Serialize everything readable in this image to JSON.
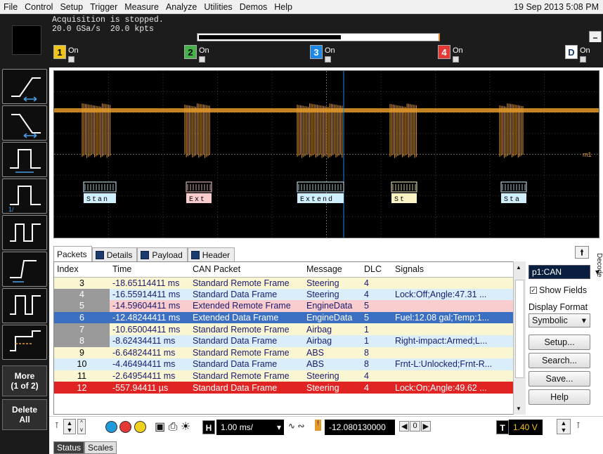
{
  "menu": [
    "File",
    "Control",
    "Setup",
    "Trigger",
    "Measure",
    "Analyze",
    "Utilities",
    "Demos",
    "Help"
  ],
  "clock": "19 Sep 2013  5:08 PM",
  "acquisition": {
    "status": "Acquisition is stopped.",
    "rate": "20.0 GSa/s",
    "points": "20.0 kpts"
  },
  "channels": [
    {
      "num": "1",
      "state": "On",
      "color": "#f0c419"
    },
    {
      "num": "2",
      "state": "On",
      "color": "#46b04a"
    },
    {
      "num": "3",
      "state": "On",
      "color": "#1e88e5"
    },
    {
      "num": "4",
      "state": "On",
      "color": "#e53935"
    },
    {
      "num": "D",
      "state": "On",
      "color": "#ffffff"
    }
  ],
  "scope": {
    "trace_color": "#e59a2c",
    "decode_labels": [
      "Stan",
      "Ext",
      "Extend",
      "St",
      "Sta"
    ],
    "marker": "m1"
  },
  "tabs": [
    "Packets",
    "Details",
    "Payload",
    "Header"
  ],
  "table": {
    "headers": [
      "Index",
      "Time",
      "CAN Packet",
      "Message",
      "DLC",
      "Signals"
    ],
    "rows": [
      {
        "index": "3",
        "time": "-18.65114411 ms",
        "packet": "Standard Remote Frame",
        "message": "Steering",
        "dlc": "4",
        "signals": ""
      },
      {
        "index": "4",
        "time": "-16.55914411 ms",
        "packet": "Standard Data Frame",
        "message": "Steering",
        "dlc": "4",
        "signals": "Lock:Off;Angle:47.31 ..."
      },
      {
        "index": "5",
        "time": "-14.59604411 ms",
        "packet": "Extended Remote Frame",
        "message": "EngineData",
        "dlc": "5",
        "signals": ""
      },
      {
        "index": "6",
        "time": "-12.48244411 ms",
        "packet": "Extended Data Frame",
        "message": "EngineData",
        "dlc": "5",
        "signals": "Fuel:12.08 gal;Temp:1..."
      },
      {
        "index": "7",
        "time": "-10.65004411 ms",
        "packet": "Standard Remote Frame",
        "message": "Airbag",
        "dlc": "1",
        "signals": ""
      },
      {
        "index": "8",
        "time": "-8.62434411 ms",
        "packet": "Standard Data Frame",
        "message": "Airbag",
        "dlc": "1",
        "signals": "Right-impact:Armed;L..."
      },
      {
        "index": "9",
        "time": "-6.64824411 ms",
        "packet": "Standard Remote Frame",
        "message": "ABS",
        "dlc": "8",
        "signals": ""
      },
      {
        "index": "10",
        "time": "-4.46494411 ms",
        "packet": "Standard Data Frame",
        "message": "ABS",
        "dlc": "8",
        "signals": "Frnt-L:Unlocked;Frnt-R..."
      },
      {
        "index": "11",
        "time": "-2.64954411 ms",
        "packet": "Standard Remote Frame",
        "message": "Steering",
        "dlc": "4",
        "signals": ""
      },
      {
        "index": "12",
        "time": "-557.94411 µs",
        "packet": "Standard Data Frame",
        "message": "Steering",
        "dlc": "4",
        "signals": "Lock:On;Angle:49.62 ..."
      }
    ]
  },
  "decode": {
    "side_tab": "Decode",
    "bus": "p1:CAN",
    "show_fields": "Show Fields",
    "display_format_label": "Display Format",
    "display_format": "Symbolic",
    "buttons": [
      "Setup...",
      "Search...",
      "Save...",
      "Help"
    ]
  },
  "left": {
    "more": "More",
    "page": "(1 of 2)",
    "delete": "Delete",
    "delete2": "All"
  },
  "toolbar": {
    "timebase": "1.00 ms/",
    "delay": "-12.080130000 ms",
    "delay_step": "0",
    "trigger_level": "1.40 V",
    "h_label": "H",
    "t_label": "T"
  },
  "status_tabs": [
    "Status",
    "Scales"
  ]
}
